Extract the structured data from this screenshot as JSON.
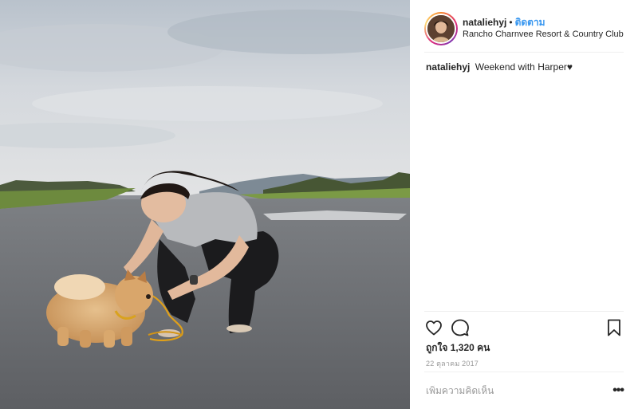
{
  "post": {
    "photo_icon": "photo-image",
    "header": {
      "username": "nataliehyj",
      "separator": "•",
      "follow_label": "ติดตาม",
      "location": "Rancho Charnvee Resort & Country Club",
      "accent_color": "#3897f0"
    },
    "caption": {
      "username": "nataliehyj",
      "text": "Weekend with Harper♥"
    },
    "actions": {
      "like_icon": "heart-outline-icon",
      "comment_icon": "speech-bubble-icon",
      "save_icon": "bookmark-icon"
    },
    "likes_text": "ถูกใจ 1,320 คน",
    "date": "22 ตุลาคม 2017",
    "comment": {
      "placeholder": "เพิ่มความคิดเห็น",
      "more_label": "•••"
    }
  }
}
